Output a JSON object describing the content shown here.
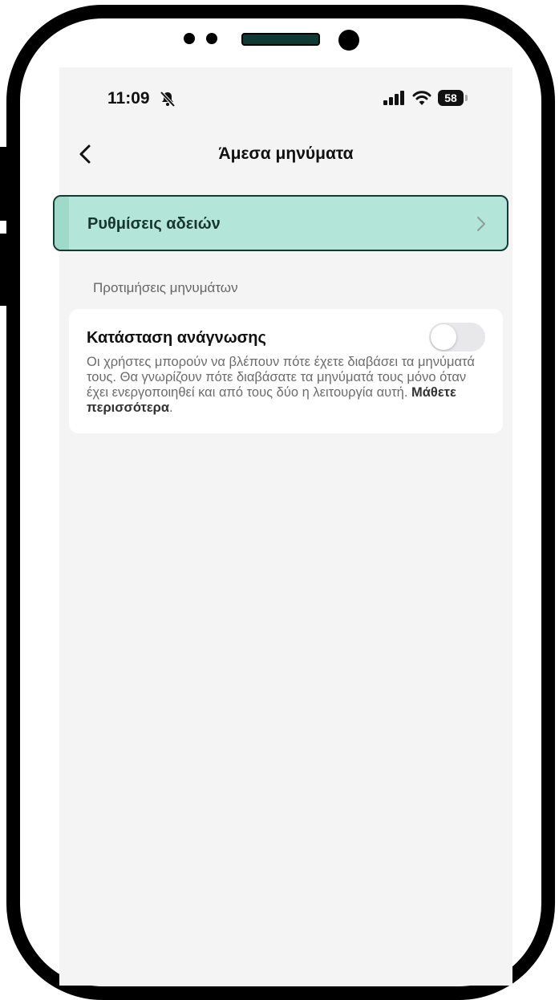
{
  "status_bar": {
    "time": "11:09",
    "battery": "58"
  },
  "header": {
    "title": "Άμεσα μηνύματα"
  },
  "permissions": {
    "label": "Ρυθμίσεις αδειών"
  },
  "preferences": {
    "section_title": "Προτιμήσεις μηνυμάτων",
    "read_receipts": {
      "title": "Κατάσταση ανάγνωσης",
      "description": "Οι χρήστες μπορούν να βλέπουν πότε έχετε διαβάσει τα μηνύματά τους. Θα γνωρίζουν πότε διαβάσατε τα μηνύματά τους μόνο όταν έχει ενεργοποιηθεί και από τους δύο η λειτουργία αυτή.",
      "learn_more": "Μάθετε περισσότερα",
      "enabled": false
    }
  },
  "colors": {
    "highlight": "#b3e5d8",
    "screen_bg": "#f4f4f4"
  }
}
